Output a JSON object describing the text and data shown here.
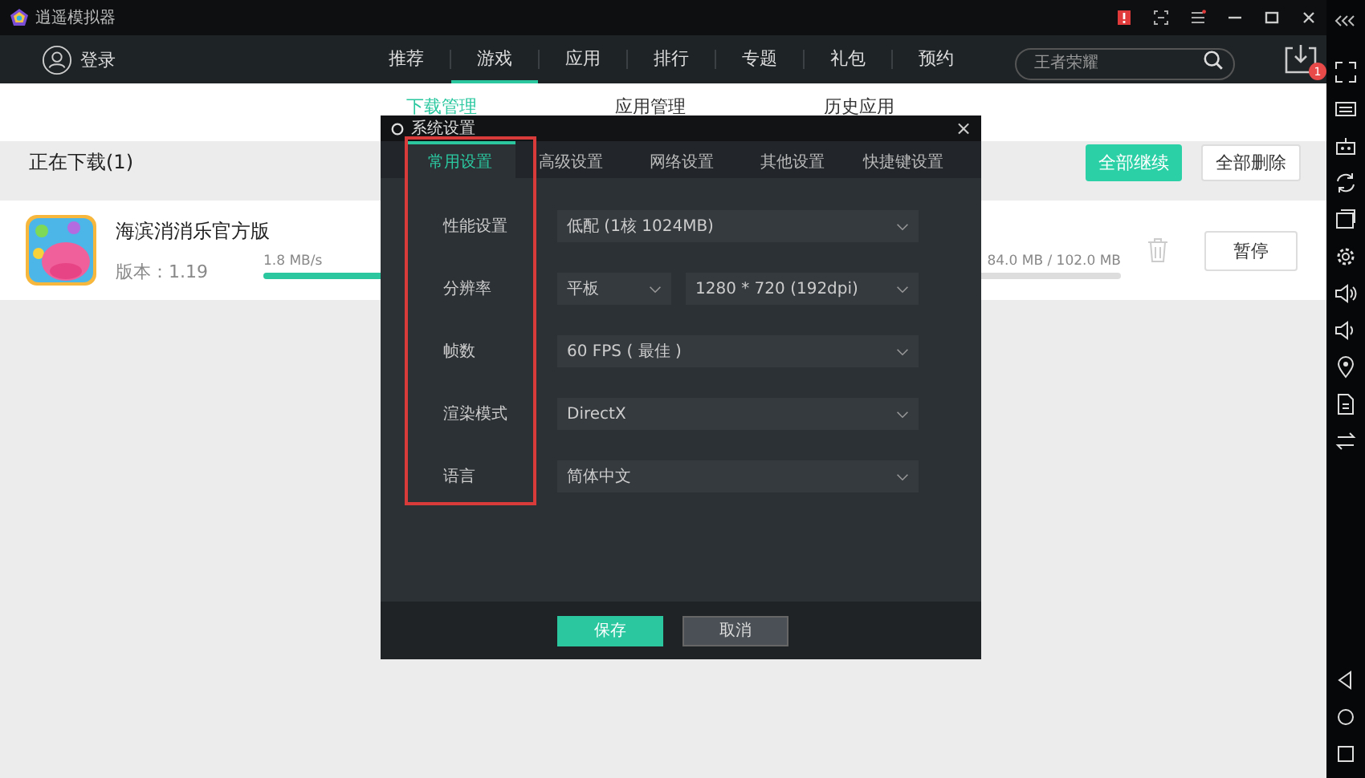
{
  "window": {
    "title": "逍遥模拟器"
  },
  "nav": {
    "login": "登录",
    "tabs": [
      {
        "label": "推荐",
        "selected": false
      },
      {
        "label": "游戏",
        "selected": true
      },
      {
        "label": "应用",
        "selected": false
      },
      {
        "label": "排行",
        "selected": false
      },
      {
        "label": "专题",
        "selected": false
      },
      {
        "label": "礼包",
        "selected": false
      },
      {
        "label": "预约",
        "selected": false
      }
    ],
    "search": {
      "placeholder": "王者荣耀"
    },
    "download_badge": "1"
  },
  "subtabs": [
    {
      "label": "下载管理",
      "selected": true
    },
    {
      "label": "应用管理",
      "selected": false
    },
    {
      "label": "历史应用",
      "selected": false
    }
  ],
  "downloads": {
    "heading": "正在下载(1)",
    "buttons": [
      "全部继续",
      "全部删除"
    ],
    "items": [
      {
        "name": "海滨消消乐官方版",
        "version": "版本：1.19",
        "speed": "1.8 MB/s",
        "size": "84.0 MB / 102.0 MB",
        "level": 0.82,
        "button": "暂停"
      }
    ]
  },
  "dialog": {
    "title": "系统设置",
    "close": "×",
    "tabs": [
      {
        "label": "常用设置",
        "selected": true
      },
      {
        "label": "高级设置",
        "selected": false
      },
      {
        "label": "网络设置",
        "selected": false
      },
      {
        "label": "其他设置",
        "selected": false
      },
      {
        "label": "快捷键设置",
        "selected": false
      }
    ],
    "rows": [
      {
        "label": "性能设置",
        "selects": [
          "低配 (1核 1024MB)"
        ]
      },
      {
        "label": "分辨率",
        "selects": [
          "平板",
          "1280 * 720 (192dpi)"
        ]
      },
      {
        "label": "帧数",
        "selects": [
          "60 FPS ( 最佳 )"
        ]
      },
      {
        "label": "渲染模式",
        "selects": [
          "DirectX"
        ]
      },
      {
        "label": "语言",
        "selects": [
          "简体中文"
        ]
      }
    ],
    "buttons": [
      {
        "label": "保存",
        "kind": "primary"
      },
      {
        "label": "取消",
        "kind": "secondary"
      }
    ]
  }
}
